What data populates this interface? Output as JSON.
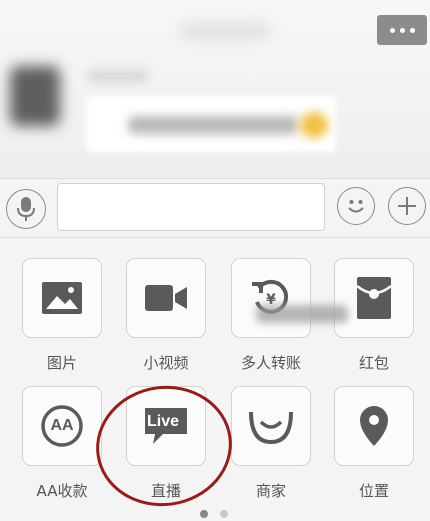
{
  "chat": {
    "more_button_icon": "more-dots-icon"
  },
  "input_bar": {
    "text_value": "",
    "voice_icon": "microphone-icon",
    "emoji_icon": "smiley-icon",
    "plus_icon": "plus-icon"
  },
  "panel": {
    "items": [
      {
        "label": "图片",
        "icon": "image-icon"
      },
      {
        "label": "小视频",
        "icon": "video-camera-icon"
      },
      {
        "label": "多人转账",
        "icon": "transfer-icon"
      },
      {
        "label": "红包",
        "icon": "red-packet-icon"
      },
      {
        "label": "AA收款",
        "icon": "aa-icon"
      },
      {
        "label": "直播",
        "icon": "live-icon"
      },
      {
        "label": "商家",
        "icon": "merchant-icon"
      },
      {
        "label": "位置",
        "icon": "location-pin-icon"
      }
    ],
    "live_icon_text": "Live",
    "aa_icon_text": "AA",
    "page_count": 2,
    "active_page": 1
  },
  "colors": {
    "accent_circle": "#9a1a1a",
    "icon_gray": "#5a5a5a"
  }
}
